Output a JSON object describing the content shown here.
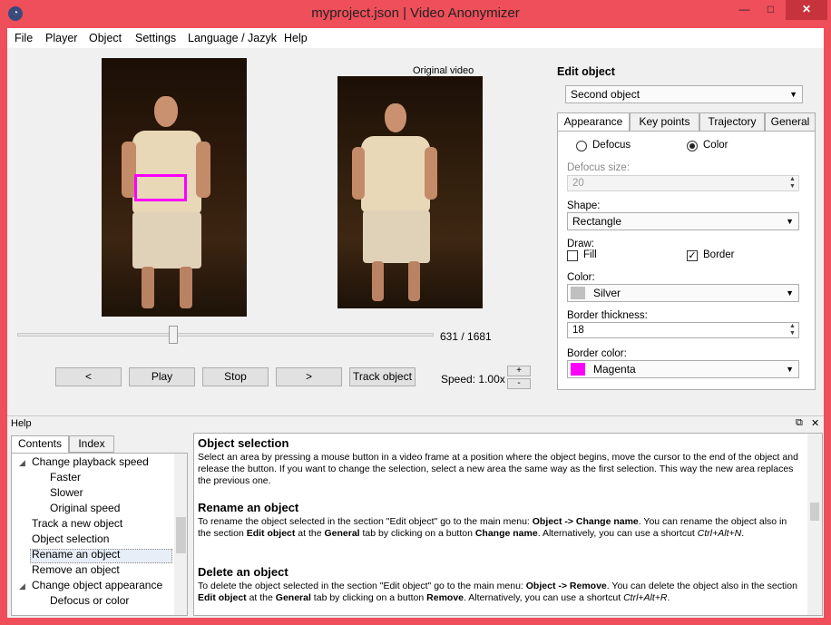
{
  "window": {
    "title": "myproject.json | Video Anonymizer",
    "controls": {
      "minimize": "—",
      "maximize": "□",
      "close": "✕"
    }
  },
  "menu": [
    "File",
    "Player",
    "Object",
    "Settings",
    "Language / Jazyk",
    "Help"
  ],
  "player": {
    "original_label": "Original video",
    "frame_counter": "631 / 1681",
    "buttons": {
      "prev": "<",
      "play": "Play",
      "stop": "Stop",
      "next": ">",
      "track": "Track object"
    },
    "speed_label": "Speed:",
    "speed_value": "1.00x",
    "speed_plus": "+",
    "speed_minus": "-",
    "position_fraction": 0.375
  },
  "edit_object": {
    "title": "Edit object",
    "selected": "Second object",
    "tabs": [
      "Appearance",
      "Key points",
      "Trajectory",
      "General"
    ],
    "active_tab": "Appearance",
    "mode_defocus": "Defocus",
    "mode_color": "Color",
    "selected_mode": "Color",
    "defocus_size_label": "Defocus size:",
    "defocus_size_value": "20",
    "shape_label": "Shape:",
    "shape_value": "Rectangle",
    "draw_label": "Draw:",
    "fill_label": "Fill",
    "fill_checked": false,
    "border_label": "Border",
    "border_checked": true,
    "color_label": "Color:",
    "color_value": "Silver",
    "color_hex": "#c0c0c0",
    "border_thickness_label": "Border thickness:",
    "border_thickness_value": "18",
    "border_color_label": "Border color:",
    "border_color_value": "Magenta",
    "border_color_hex": "#ff00ff"
  },
  "help": {
    "title": "Help",
    "tabs": [
      "Contents",
      "Index"
    ],
    "toc": [
      "Change playback speed",
      "Faster",
      "Slower",
      "Original speed",
      "Track a new object",
      "Object selection",
      "Rename an object",
      "Remove an object",
      "Change object appearance",
      "Defocus or color"
    ],
    "sections": [
      {
        "heading": "Object selection",
        "text": "Select an area by pressing a mouse button in a video frame at a position where the object begins, move the cursor to the end of the object and release the button. If you want to change the selection, select a new area the same way as the first selection. This way the new area replaces the previous one."
      },
      {
        "heading": "Rename an object",
        "text_a": "To rename the object selected in the section \"Edit object\" go to the main menu: ",
        "bold_a": "Object -> Change name",
        "text_b": ". You can rename the object also in the section ",
        "bold_b": "Edit object",
        "text_c": " at the ",
        "bold_c": "General",
        "text_d": " tab by clicking on a button ",
        "bold_d": "Change name",
        "text_e": ". Alternatively, you can use a shortcut ",
        "italic_e": "Ctrl+Alt+N",
        "text_f": "."
      },
      {
        "heading": "Delete an object",
        "text_a": "To delete the object selected in the section \"Edit object\" go to the main menu: ",
        "bold_a": "Object -> Remove",
        "text_b": ". You can delete the object also in the section ",
        "bold_b": "Edit object",
        "text_c": " at the ",
        "bold_c": "General",
        "text_d": " tab by clicking on a button ",
        "bold_d": "Remove",
        "text_e": ". Alternatively, you can use a shortcut ",
        "italic_e": "Ctrl+Alt+R",
        "text_f": "."
      }
    ]
  }
}
